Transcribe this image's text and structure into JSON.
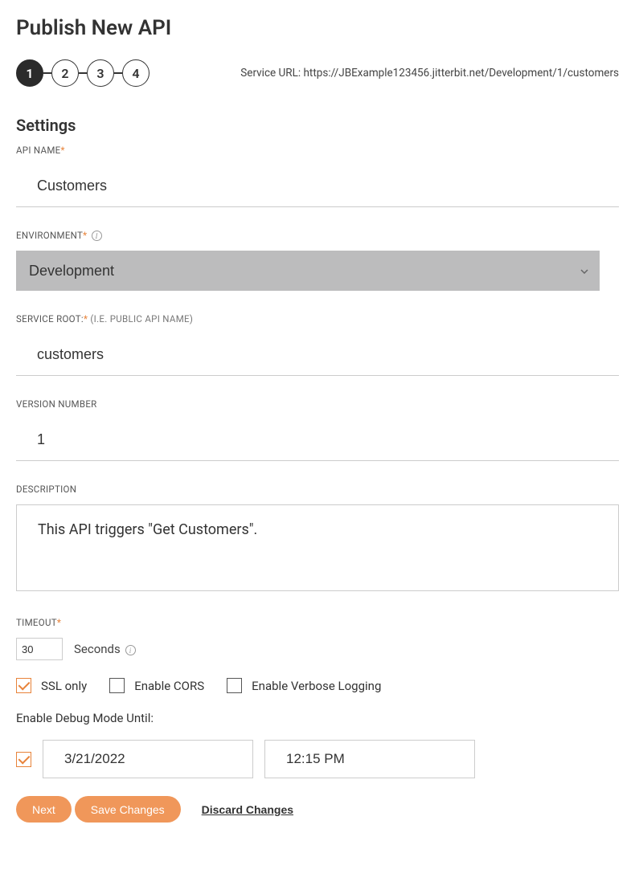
{
  "page": {
    "title": "Publish New API",
    "service_url_label": "Service URL: ",
    "service_url_value": "https://JBExample123456.jitterbit.net/Development/1/customers"
  },
  "stepper": {
    "steps": [
      "1",
      "2",
      "3",
      "4"
    ],
    "active": 1
  },
  "section": {
    "title": "Settings"
  },
  "fields": {
    "api_name": {
      "label": "API NAME",
      "value": "Customers"
    },
    "environment": {
      "label": "ENVIRONMENT",
      "value": "Development"
    },
    "service_root": {
      "label": "SERVICE ROOT:",
      "hint": " (I.E. PUBLIC API NAME)",
      "value": "customers"
    },
    "version": {
      "label": "VERSION NUMBER",
      "value": "1"
    },
    "description": {
      "label": "DESCRIPTION",
      "value": "This API triggers \"Get Customers\"."
    },
    "timeout": {
      "label": "TIMEOUT",
      "value": "30",
      "unit": "Seconds"
    }
  },
  "checkboxes": {
    "ssl_only": {
      "label": "SSL only",
      "checked": true
    },
    "enable_cors": {
      "label": "Enable CORS",
      "checked": false
    },
    "enable_verbose": {
      "label": "Enable Verbose Logging",
      "checked": false
    }
  },
  "debug": {
    "label": "Enable Debug Mode Until:",
    "checked": true,
    "date": "3/21/2022",
    "time": "12:15 PM"
  },
  "buttons": {
    "next": "Next",
    "save": "Save Changes",
    "discard": "Discard Changes"
  }
}
